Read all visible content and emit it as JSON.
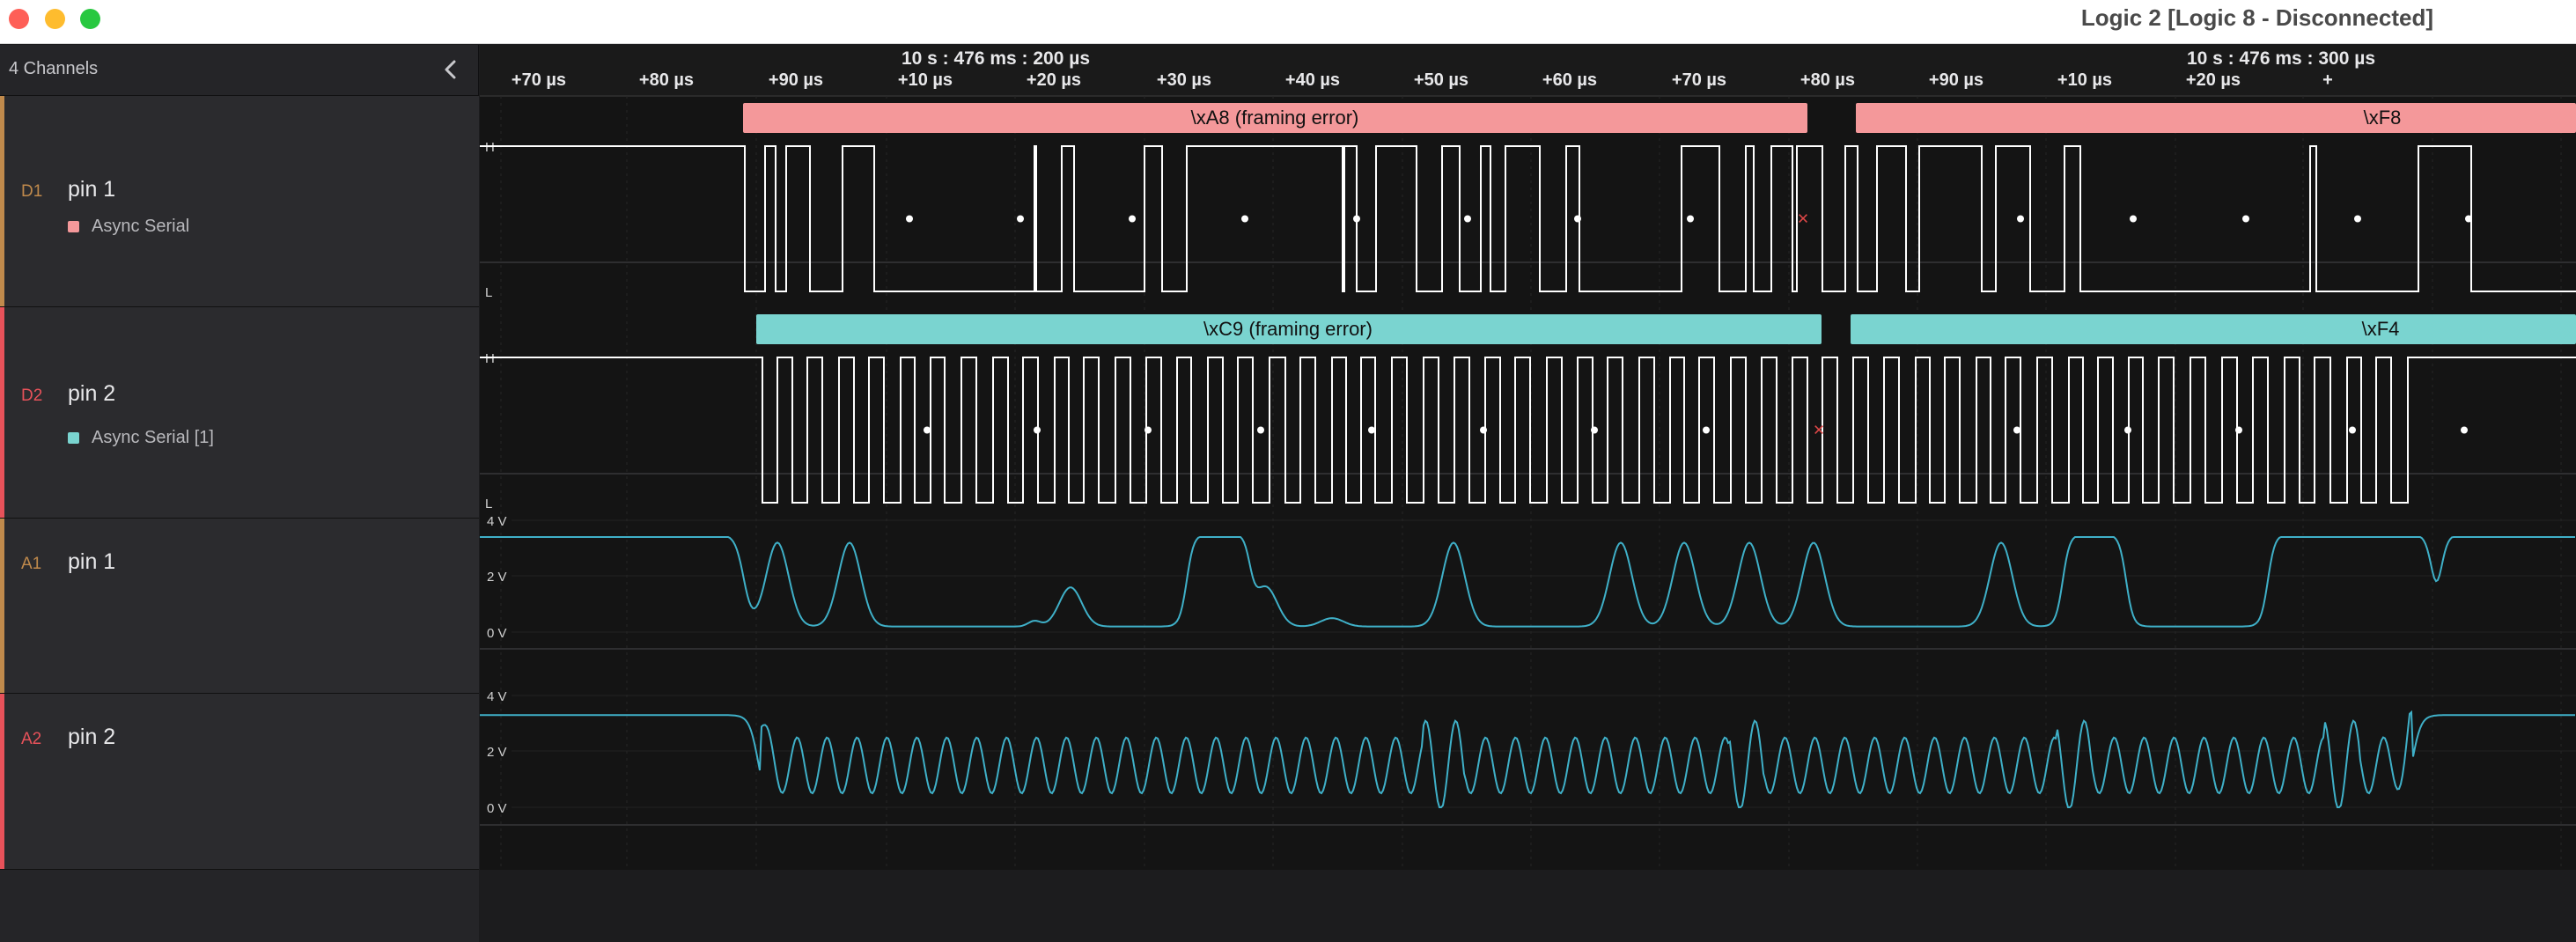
{
  "window": {
    "title": "Logic 2 [Logic 8 - Disconnected]"
  },
  "sidebar": {
    "channel_count": "4 Channels",
    "collapse_icon": "chevron-left-icon"
  },
  "channels": [
    {
      "id": "D1",
      "name": "pin 1",
      "analyzer": "Async Serial",
      "color": "#c08a4c",
      "analyzer_color": "#f4989a"
    },
    {
      "id": "D2",
      "name": "pin 2",
      "analyzer": "Async Serial [1]",
      "color": "#e8525a",
      "analyzer_color": "#7ad4d0"
    },
    {
      "id": "A1",
      "name": "pin 1",
      "color": "#c08a4c"
    },
    {
      "id": "A2",
      "name": "pin 2",
      "color": "#e8525a"
    }
  ],
  "timeline": {
    "markers": [
      "10 s : 476 ms : 200 µs",
      "10 s : 476 ms : 300 µs"
    ],
    "ticks": [
      "+70 µs",
      "+80 µs",
      "+90 µs",
      "+10 µs",
      "+20 µs",
      "+30 µs",
      "+40 µs",
      "+50 µs",
      "+60 µs",
      "+70 µs",
      "+80 µs",
      "+90 µs",
      "+10 µs",
      "+20 µs",
      "+"
    ]
  },
  "decoders": [
    {
      "channel": "D1",
      "frames": [
        "\\xA8 (framing error)",
        "\\xF8"
      ]
    },
    {
      "channel": "D2",
      "frames": [
        "\\xC9 (framing error)",
        "\\xF4"
      ]
    }
  ],
  "digital_levels": {
    "high": "H",
    "low": "L"
  },
  "analog_axis": [
    "4 V",
    "2 V",
    "0 V"
  ],
  "colors": {
    "analog_trace": "#3fb0c8",
    "error_marker": "#e04848",
    "digital_trace": "#ffffff"
  }
}
